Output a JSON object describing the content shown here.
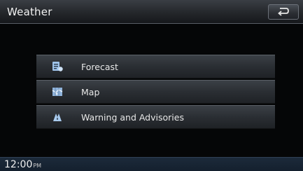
{
  "header": {
    "title": "Weather",
    "back_icon": "back-arrow-icon"
  },
  "menu": {
    "items": [
      {
        "label": "Forecast",
        "icon": "forecast-icon"
      },
      {
        "label": "Map",
        "icon": "map-icon"
      },
      {
        "label": "Warning and Advisories",
        "icon": "warning-icon"
      }
    ]
  },
  "status_bar": {
    "time": "12:00",
    "ampm": "PM"
  },
  "colors": {
    "accent": "#8fb8e8",
    "text": "#e8e8e8",
    "background": "#050607"
  }
}
